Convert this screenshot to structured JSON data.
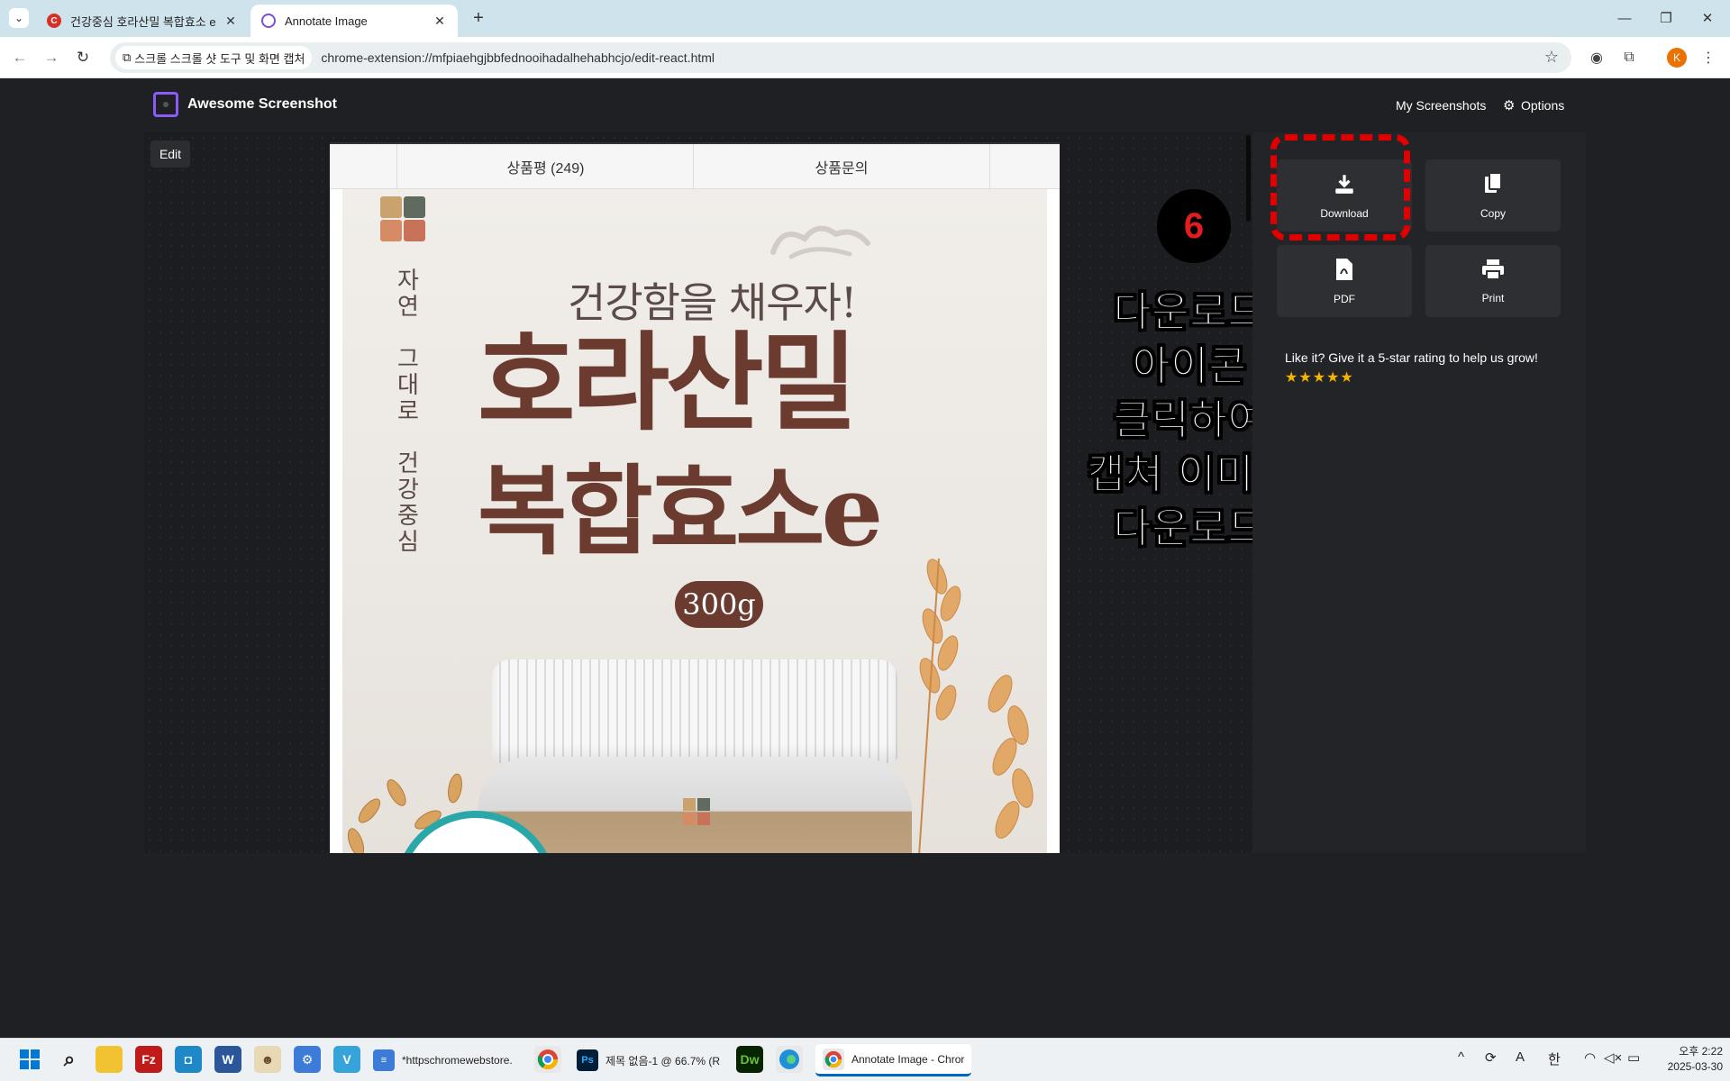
{
  "browser": {
    "tabs": [
      {
        "title": "건강중심 호라산밀 복합효소 e",
        "favicon": "C",
        "active": false
      },
      {
        "title": "Annotate Image",
        "active": true
      }
    ],
    "address_chip": "스크롤 스크롤 샷 도구 및 화면 캡처",
    "url": "chrome-extension://mfpiaehgjbbfednooihadalhehabhcjo/edit-react.html",
    "profile_initial": "K"
  },
  "app": {
    "brand": "Awesome Screenshot",
    "nav": {
      "my_screenshots": "My Screenshots",
      "options": "Options"
    },
    "edit_label": "Edit"
  },
  "preview": {
    "tabs": [
      "상품평 (249)",
      "상품문의"
    ],
    "vertical_text": "자\n연\n \n그\n대\n로\n \n건\n강\n중\n심",
    "slogan": "건강함을 채우자!",
    "title_line1": "호라산밀",
    "title_line2": "복합효소e",
    "weight": "300g"
  },
  "annotation": {
    "step_number": "6",
    "callout_lines": [
      "다운로드",
      "아이콘",
      "클릭하여",
      "캡쳐 이미지",
      "다운로드"
    ]
  },
  "actions": [
    {
      "label": "Download",
      "icon": "download-icon"
    },
    {
      "label": "Copy",
      "icon": "copy-icon"
    },
    {
      "label": "PDF",
      "icon": "pdf-icon"
    },
    {
      "label": "Print",
      "icon": "print-icon"
    }
  ],
  "rating": {
    "text": "Like it? Give it a 5-star rating to help us grow!",
    "stars": "★★★★★"
  },
  "taskbar": {
    "apps": [
      {
        "label": "*httpschromewebstore."
      },
      {
        "label": "제목 없음-1 @ 66.7% (R"
      },
      {
        "label": "Annotate Image - Chror"
      }
    ],
    "tray": {
      "ime_a": "A",
      "ime_han": "한",
      "volume": "◁×"
    },
    "clock": {
      "time": "오후 2:22",
      "date": "2025-03-30"
    }
  },
  "colors": {
    "accent_highlight": "#e10000",
    "product_brown": "#6b3b30",
    "star_gold": "#f5b400"
  }
}
